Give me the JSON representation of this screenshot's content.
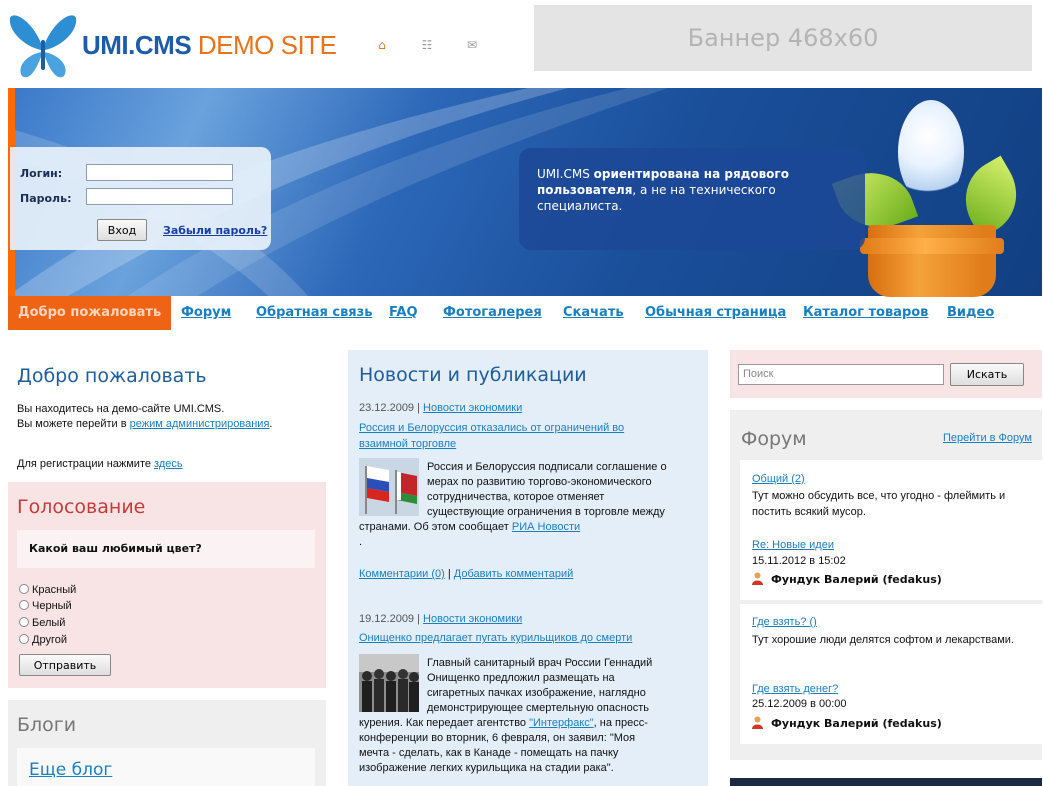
{
  "header": {
    "logo_umi": "UMI.CMS",
    "logo_demo": " DEMO SITE",
    "icons": [
      "home-icon",
      "sitemap-icon",
      "mail-icon"
    ],
    "banner_text": "Баннер 468x60"
  },
  "login": {
    "login_label": "Логин:",
    "password_label": "Пароль:",
    "login_value": "",
    "password_value": "",
    "submit_label": "Вход",
    "forgot_label": "Забыли пароль?"
  },
  "slogan": {
    "part1": "UMI.CMS ",
    "bold": "ориентирована на рядового пользователя",
    "part2": ", а не на технического специалиста."
  },
  "nav": {
    "items": [
      "Добро пожаловать",
      "Форум",
      "Обратная связь",
      "FAQ",
      "Фотогалерея",
      "Скачать",
      "Обычная страница",
      "Каталог товаров",
      "Видео"
    ]
  },
  "welcome": {
    "title": "Добро пожаловать",
    "line1": "Вы находитесь на демо-сайте UMI.CMS.",
    "line2_prefix": "Вы можете перейти в ",
    "line2_link": "режим администрирования",
    "line2_suffix": ".",
    "reg_prefix": "Для регистрации нажмите ",
    "reg_link": "здесь"
  },
  "poll": {
    "title": "Голосование",
    "question": "Какой ваш любимый цвет?",
    "options": [
      "Красный",
      "Черный",
      "Белый",
      "Другой"
    ],
    "submit_label": "Отправить"
  },
  "blogs": {
    "title": "Блоги",
    "item": "Еще блог"
  },
  "news": {
    "title": "Новости и публикации",
    "items": [
      {
        "date": "23.12.2009",
        "sep": " | ",
        "category": "Новости экономики",
        "headline": "Россия и Белоруссия отказались от ограничений во взаимной торговле",
        "body_lines": [
          "Россия и Белоруссия подписали соглашение о",
          "мерах по развитию торгово-экономического",
          "сотрудничества, которое отменяет",
          "существующие ограничения в торговле между"
        ],
        "body_tail_prefix": "странами. Об этом сообщает ",
        "body_tail_link": "РИА Новости",
        "body_dot": ".",
        "comments": "Комментарии (0)",
        "add_comment": "Добавить комментарий"
      },
      {
        "date": "19.12.2009",
        "sep": " | ",
        "category": "Новости экономики",
        "headline": "Онищенко предлагает пугать курильщиков до смерти",
        "body_lines": [
          "Главный санитарный врач России Геннадий",
          "Онищенко предложил размещать на",
          "сигаретных пачках изображение, наглядно",
          "демонстрирующее смертельную опасность"
        ],
        "body_tail_prefix": "курения. Как передает агентство ",
        "body_tail_link": "\"Интерфакс\"",
        "body_tail_suffix": ", на пресс-",
        "body_more": [
          "конференции во вторник, 6 февраля, он заявил: \"Моя",
          "мечта - сделать, как в Канаде - помещать на пачку",
          "изображение легких курильщика на стадии рака\"."
        ]
      }
    ]
  },
  "search": {
    "placeholder": "Поиск",
    "submit_label": "Искать"
  },
  "forum": {
    "title": "Форум",
    "goto_label": "Перейти в Форум",
    "sections": [
      {
        "name": "Общий (2)",
        "desc": "Тут можно обсудить все, что угодно - флеймить и постить всякий мусор.",
        "last_topic": "Re: Новые идеи",
        "last_date": "15.11.2012 в 15:02",
        "last_user": "Фундук Валерий (fedakus)"
      },
      {
        "name": "Где взять? ()",
        "desc": "Тут хорошие люди делятся софтом и лекарствами.",
        "last_topic": "Где взять денег?",
        "last_date": "25.12.2009 в 00:00",
        "last_user": "Фундук Валерий (fedakus)"
      }
    ]
  },
  "colors": {
    "accent_orange": "#ef6414",
    "link_blue": "#1a7fc1",
    "title_blue": "#1e5d9c",
    "poll_red": "#c23d3a"
  }
}
